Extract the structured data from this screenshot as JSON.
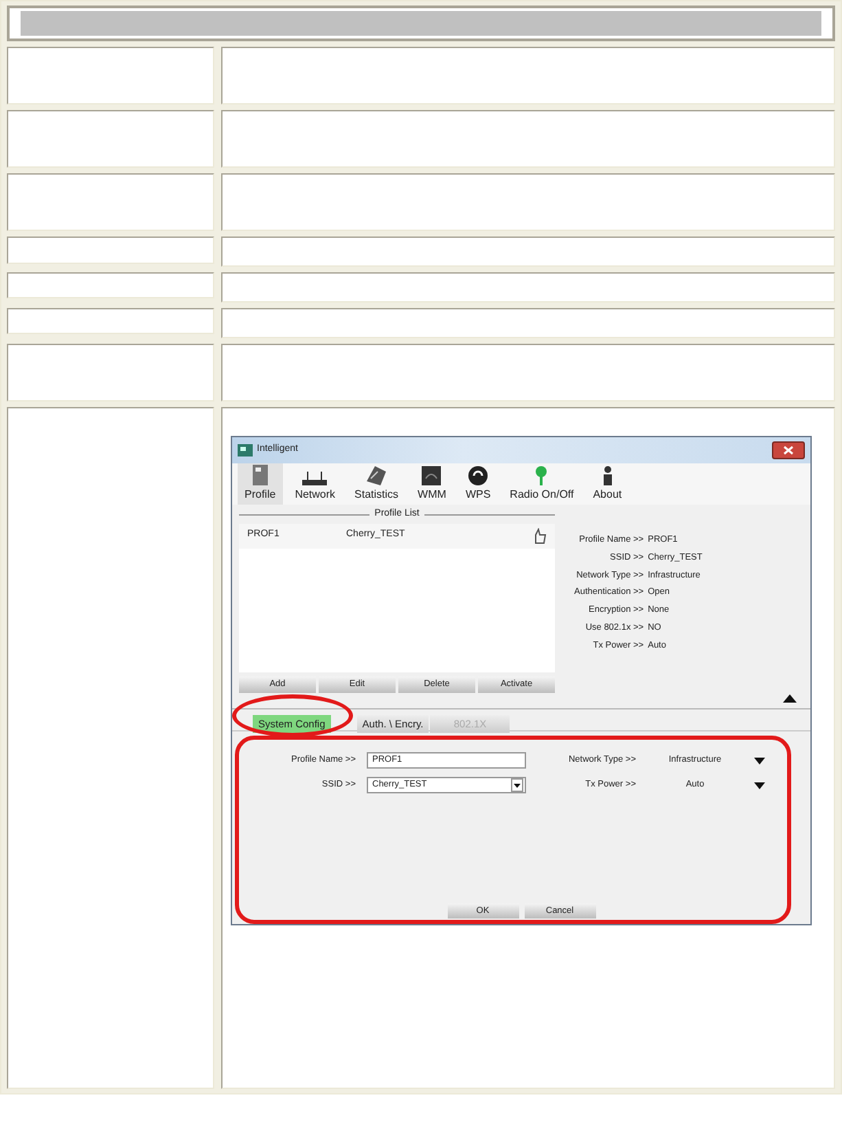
{
  "window": {
    "title": "Intelligent"
  },
  "toolbar": [
    {
      "label": "Profile",
      "selected": true
    },
    {
      "label": "Network",
      "selected": false
    },
    {
      "label": "Statistics",
      "selected": false
    },
    {
      "label": "WMM",
      "selected": false
    },
    {
      "label": "WPS",
      "selected": false
    },
    {
      "label": "Radio On/Off",
      "selected": false
    },
    {
      "label": "About",
      "selected": false
    }
  ],
  "profile_list": {
    "title": "Profile List",
    "rows": [
      {
        "name": "PROF1",
        "ssid": "Cherry_TEST",
        "active": true
      }
    ],
    "buttons": [
      "Add",
      "Edit",
      "Delete",
      "Activate"
    ]
  },
  "details": [
    {
      "label": "Profile Name >>",
      "value": "PROF1"
    },
    {
      "label": "SSID >>",
      "value": "Cherry_TEST"
    },
    {
      "label": "Network Type >>",
      "value": "Infrastructure"
    },
    {
      "label": "Authentication >>",
      "value": "Open"
    },
    {
      "label": "Encryption >>",
      "value": "None"
    },
    {
      "label": "Use 802.1x >>",
      "value": "NO"
    },
    {
      "label": "Tx Power >>",
      "value": "Auto"
    }
  ],
  "tabs": [
    {
      "label": "System Config",
      "selected": true,
      "disabled": false
    },
    {
      "label": "Auth. \\ Encry.",
      "selected": false,
      "disabled": false
    },
    {
      "label": "802.1X",
      "selected": false,
      "disabled": true
    }
  ],
  "form": {
    "profile_name": {
      "label": "Profile Name >>",
      "value": "PROF1"
    },
    "ssid": {
      "label": "SSID >>",
      "value": "Cherry_TEST"
    },
    "network_type": {
      "label": "Network Type >>",
      "value": "Infrastructure"
    },
    "tx_power": {
      "label": "Tx Power >>",
      "value": "Auto"
    }
  },
  "dialog_buttons": [
    "OK",
    "Cancel"
  ]
}
